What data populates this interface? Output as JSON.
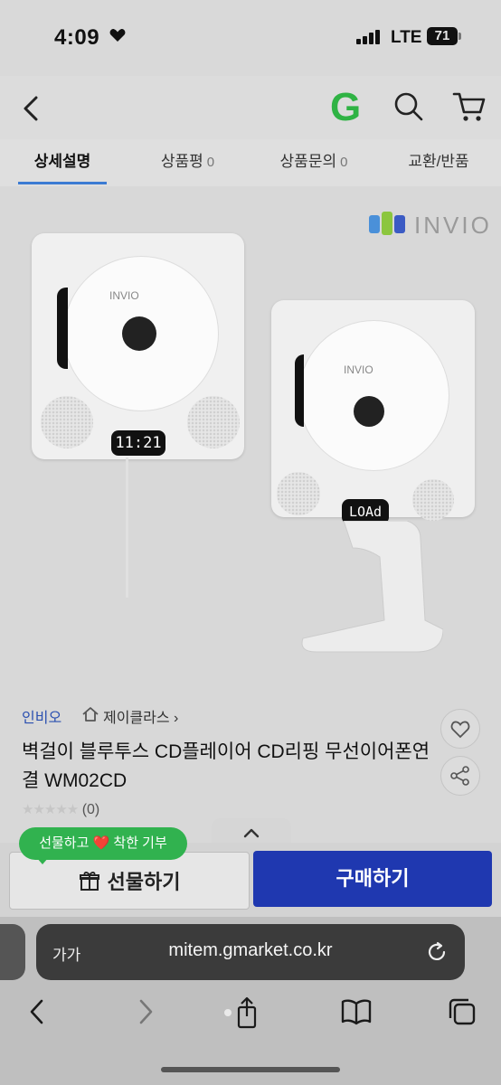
{
  "status": {
    "time": "4:09",
    "network": "LTE",
    "battery": "71"
  },
  "nav": {
    "logo": "G"
  },
  "tabs": [
    {
      "label": "상세설명",
      "count": ""
    },
    {
      "label": "상품평",
      "count": "0"
    },
    {
      "label": "상품문의",
      "count": "0"
    },
    {
      "label": "교환/반품",
      "count": ""
    }
  ],
  "product_image": {
    "brand_logo_text": "INVIO",
    "disc_logo_text": "INVIO",
    "display_left": "11:21",
    "display_right": "LOAd"
  },
  "product": {
    "brand": "인비오",
    "seller": "제이클라스 ›",
    "title": "벽걸이 블루투스 CD플레이어 CD리핑 무선이어폰연결 WM02CD",
    "stars": "★★★★★",
    "review_count": "(0)"
  },
  "actions": {
    "gift_pill": "선물하고 ❤️ 착한 기부",
    "gift_button": "선물하기",
    "buy_button": "구매하기"
  },
  "browser": {
    "text_size": "가가",
    "url": "mitem.gmarket.co.kr"
  },
  "colors": {
    "buy": "#1f38b0",
    "gift_pill": "#31b24f",
    "tab_active": "#3c7bd3",
    "logo": "#2fb344"
  }
}
